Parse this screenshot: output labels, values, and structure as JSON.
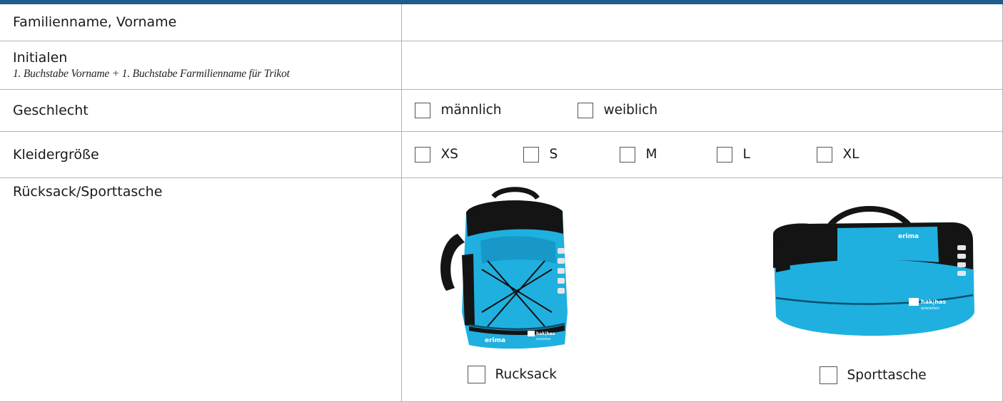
{
  "rows": {
    "name": {
      "label": "Familienname, Vorname"
    },
    "initials": {
      "label": "Initialen",
      "hint": "1. Buchstabe Vorname + 1. Buchstabe Farmilienname für Trikot"
    },
    "gender": {
      "label": "Geschlecht",
      "options": [
        "männlich",
        "weiblich"
      ]
    },
    "size": {
      "label": "Kleidergröße",
      "options": [
        "XS",
        "S",
        "M",
        "L",
        "XL"
      ]
    },
    "bag": {
      "label": "Rücksack/Sporttasche",
      "options": [
        "Rucksack",
        "Sporttasche"
      ],
      "brand": "erima",
      "logo_top": "hak|has",
      "logo_bottom": "amstetten"
    }
  },
  "colors": {
    "header_bar": "#1f5b8e",
    "bag_blue": "#1fb0e0",
    "bag_black": "#141414"
  }
}
